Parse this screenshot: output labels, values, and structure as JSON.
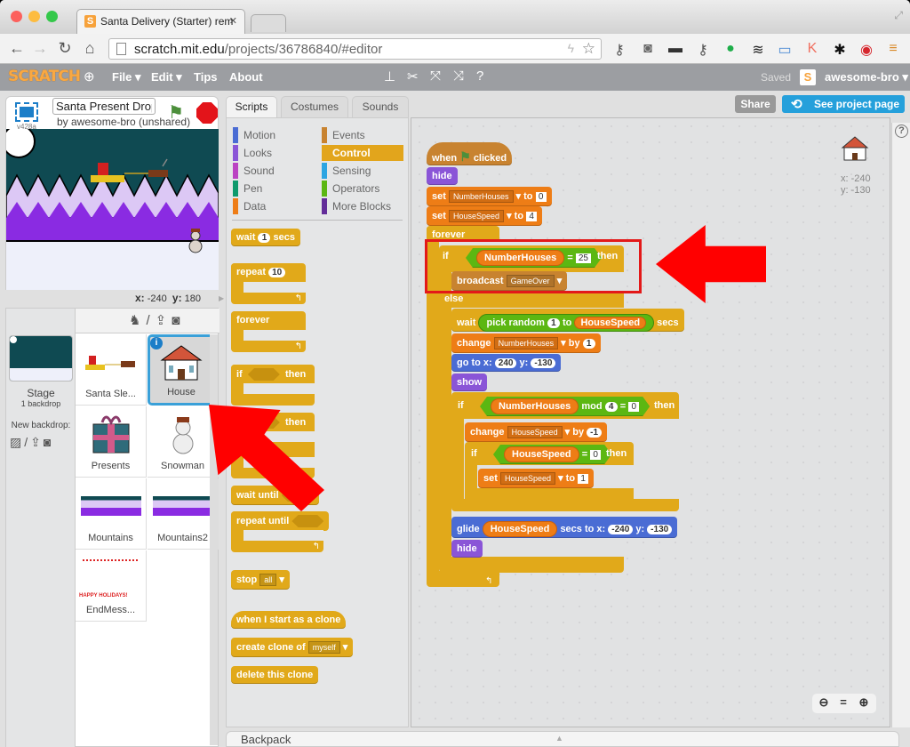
{
  "browser": {
    "tab_title": "Santa Delivery (Starter) rem",
    "tab_favicon": "S",
    "url_host": "scratch.mit.edu",
    "url_path": "/projects/36786840/#editor",
    "extensions": [
      "key-icon",
      "pocket-icon",
      "mask-icon",
      "key-icon",
      "hangouts-icon",
      "buffer-icon",
      "screenshot-icon",
      "klout-icon",
      "ninja-icon",
      "pinterest-icon",
      "menu-icon"
    ]
  },
  "scratch_menu": {
    "logo": "SCRATCH",
    "items": [
      "File ▾",
      "Edit ▾",
      "Tips",
      "About"
    ],
    "saved_label": "Saved",
    "user_name": "awesome-bro ▾",
    "user_icon": "S"
  },
  "stage_header": {
    "version": "v428a",
    "project_title": "Santa Present Drop",
    "byline": "by awesome-bro (unshared)"
  },
  "stage_coords": {
    "x_label": "x:",
    "x": "-240",
    "y_label": "y:",
    "y": "180"
  },
  "sprite_pane": {
    "stage_label": "Stage",
    "stage_backdrops": "1 backdrop",
    "new_backdrop_label": "New backdrop:",
    "sprites": [
      {
        "name": "Santa Sle...",
        "selected": false
      },
      {
        "name": "House",
        "selected": true
      },
      {
        "name": "Presents",
        "selected": false
      },
      {
        "name": "Snowman",
        "selected": false
      },
      {
        "name": "Mountains",
        "selected": false
      },
      {
        "name": "Mountains2",
        "selected": false
      },
      {
        "name": "EndMess...",
        "selected": false
      }
    ],
    "endmessage_thumb_text": "HAPPY HOLIDAYS!"
  },
  "tabs": [
    "Scripts",
    "Costumes",
    "Sounds"
  ],
  "categories": {
    "left": [
      {
        "label": "Motion",
        "color": "#4a6cd4"
      },
      {
        "label": "Looks",
        "color": "#8a55d7"
      },
      {
        "label": "Sound",
        "color": "#bb42c3"
      },
      {
        "label": "Pen",
        "color": "#0e9a6c"
      },
      {
        "label": "Data",
        "color": "#ee7d16"
      }
    ],
    "right": [
      {
        "label": "Events",
        "color": "#c88330"
      },
      {
        "label": "Control",
        "color": "#e1a91a"
      },
      {
        "label": "Sensing",
        "color": "#2ca5e2"
      },
      {
        "label": "Operators",
        "color": "#5cb712"
      },
      {
        "label": "More Blocks",
        "color": "#632d99"
      }
    ],
    "active": "Control"
  },
  "palette": {
    "wait": {
      "pre": "wait",
      "val": "1",
      "post": "secs"
    },
    "repeat": {
      "pre": "repeat",
      "val": "10"
    },
    "forever": "forever",
    "if_then": {
      "pre": "if",
      "post": "then"
    },
    "if_else": {
      "pre": "if",
      "post": "then",
      "else": "else"
    },
    "wait_until": "wait until",
    "repeat_until": "repeat until",
    "stop": {
      "pre": "stop",
      "val": "all"
    },
    "clone_hat": "when I start as a clone",
    "create_clone": {
      "pre": "create clone of",
      "val": "myself"
    },
    "delete_clone": "delete this clone"
  },
  "script": {
    "hat": {
      "pre": "when",
      "post": "clicked"
    },
    "hide1": "hide",
    "set1": {
      "pre": "set",
      "var": "NumberHouses",
      "mid": "to",
      "val": "0"
    },
    "set2": {
      "pre": "set",
      "var": "HouseSpeed",
      "mid": "to",
      "val": "4"
    },
    "forever": "forever",
    "if1": {
      "pre": "if",
      "var": "NumberHouses",
      "op": "=",
      "val": "25",
      "post": "then"
    },
    "broadcast": {
      "pre": "broadcast",
      "val": "GameOver"
    },
    "else": "else",
    "wait": {
      "pre": "wait",
      "rand": "pick random",
      "a": "1",
      "to": "to",
      "var": "HouseSpeed",
      "post": "secs"
    },
    "change1": {
      "pre": "change",
      "var": "NumberHouses",
      "mid": "by",
      "val": "1"
    },
    "goto": {
      "pre": "go to x:",
      "x": "240",
      "ylab": "y:",
      "y": "-130"
    },
    "show": "show",
    "if2": {
      "pre": "if",
      "var": "NumberHouses",
      "mod": "mod",
      "a": "4",
      "op": "=",
      "val": "0",
      "post": "then"
    },
    "change2": {
      "pre": "change",
      "var": "HouseSpeed",
      "mid": "by",
      "val": "-1"
    },
    "if3": {
      "pre": "if",
      "var": "HouseSpeed",
      "op": "=",
      "val": "0",
      "post": "then"
    },
    "set3": {
      "pre": "set",
      "var": "HouseSpeed",
      "mid": "to",
      "val": "1"
    },
    "glide": {
      "pre": "glide",
      "var": "HouseSpeed",
      "mid": "secs to x:",
      "x": "-240",
      "ylab": "y:",
      "y": "-130"
    },
    "hide2": "hide"
  },
  "sprite_info": {
    "x": "x: -240",
    "y": "y: -130"
  },
  "buttons": {
    "share": "Share",
    "see_project": "See project page"
  },
  "zoom_controls": {
    "out": "−",
    "reset": "=",
    "in": "+"
  },
  "backpack": "Backpack",
  "annotation_color": "#ff0000"
}
